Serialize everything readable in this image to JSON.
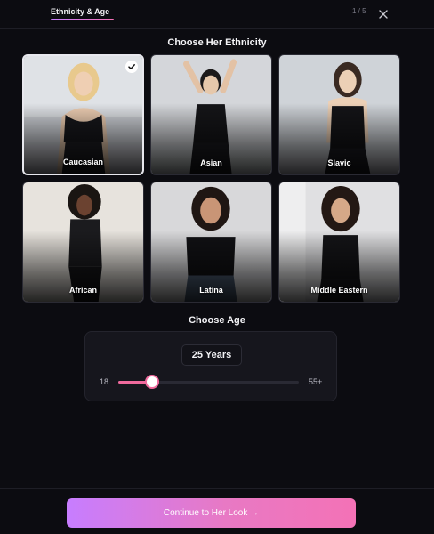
{
  "header": {
    "tab_label": "Ethnicity & Age",
    "step": "1 / 5",
    "close_icon": "close-icon"
  },
  "ethnicity": {
    "title": "Choose Her Ethnicity",
    "selected": "Caucasian",
    "options": [
      {
        "label": "Caucasian",
        "selected": true
      },
      {
        "label": "Asian",
        "selected": false
      },
      {
        "label": "Slavic",
        "selected": false
      },
      {
        "label": "African",
        "selected": false
      },
      {
        "label": "Latina",
        "selected": false
      },
      {
        "label": "Middle Eastern",
        "selected": false
      }
    ]
  },
  "age": {
    "title": "Choose Age",
    "value_display": "25 Years",
    "value": 25,
    "min_label": "18",
    "max_label": "55+",
    "min": 18,
    "max": 55
  },
  "footer": {
    "cta_label": "Continue to Her Look →"
  },
  "colors": {
    "background": "#0c0c11",
    "accent_start": "#c77dff",
    "accent_end": "#f472b6",
    "slider_fill": "#f06a9d"
  }
}
